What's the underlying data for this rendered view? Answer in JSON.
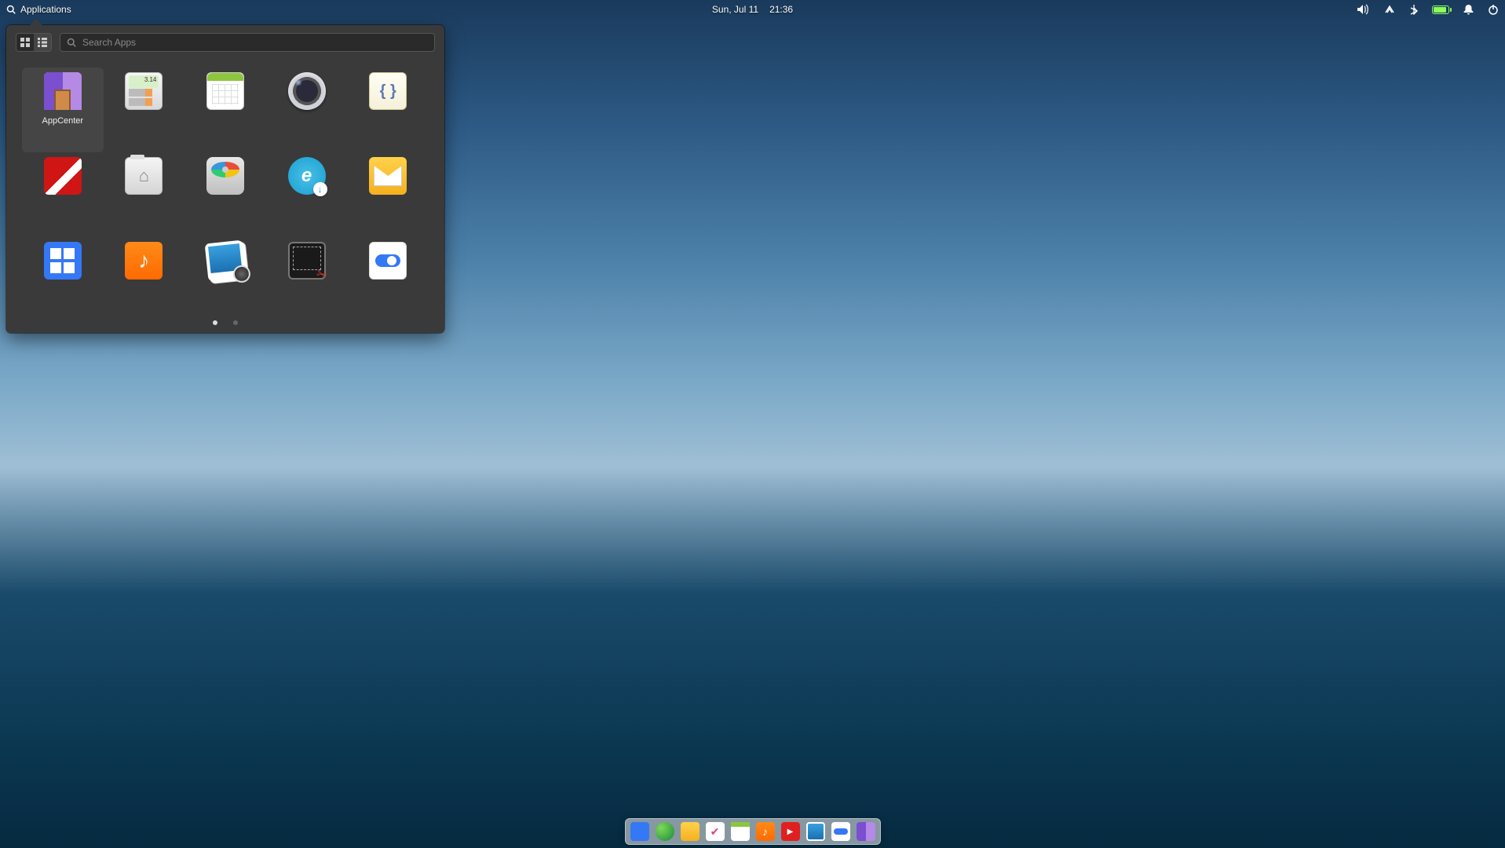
{
  "panel": {
    "applications_label": "Applications",
    "date": "Sun, Jul 11",
    "time": "21:36"
  },
  "popover": {
    "search_placeholder": "Search Apps",
    "apps": [
      {
        "id": "appcenter",
        "label": "AppCenter"
      },
      {
        "id": "calculator",
        "label": ""
      },
      {
        "id": "calendar",
        "label": ""
      },
      {
        "id": "camera",
        "label": ""
      },
      {
        "id": "code",
        "label": ""
      },
      {
        "id": "pdf",
        "label": ""
      },
      {
        "id": "files",
        "label": ""
      },
      {
        "id": "disks",
        "label": ""
      },
      {
        "id": "installer",
        "label": ""
      },
      {
        "id": "mail",
        "label": ""
      },
      {
        "id": "multitask",
        "label": ""
      },
      {
        "id": "music",
        "label": ""
      },
      {
        "id": "photos",
        "label": ""
      },
      {
        "id": "screenshot",
        "label": ""
      },
      {
        "id": "settings",
        "label": ""
      }
    ],
    "page_count": 2,
    "active_page": 0
  },
  "dock": {
    "items": [
      "multitask",
      "web",
      "mail",
      "tasks",
      "calendar",
      "music",
      "video",
      "photos",
      "settings",
      "appcenter"
    ]
  }
}
